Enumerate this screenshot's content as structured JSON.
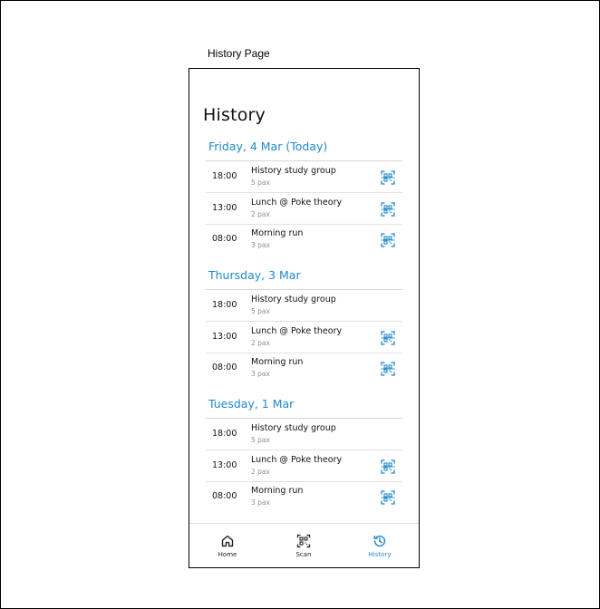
{
  "caption": "History Page",
  "title": "History",
  "sections": [
    {
      "header": "Friday, 4 Mar (Today)",
      "rows": [
        {
          "time": "18:00",
          "title": "History study group",
          "sub": "5 pax",
          "qr": true
        },
        {
          "time": "13:00",
          "title": "Lunch @ Poke theory",
          "sub": "2 pax",
          "qr": true
        },
        {
          "time": "08:00",
          "title": "Morning run",
          "sub": "3 pax",
          "qr": true
        }
      ]
    },
    {
      "header": "Thursday, 3 Mar",
      "rows": [
        {
          "time": "18:00",
          "title": "History study group",
          "sub": "5 pax",
          "qr": false
        },
        {
          "time": "13:00",
          "title": "Lunch @ Poke theory",
          "sub": "2 pax",
          "qr": true
        },
        {
          "time": "08:00",
          "title": "Morning run",
          "sub": "3 pax",
          "qr": true
        }
      ]
    },
    {
      "header": "Tuesday, 1 Mar",
      "rows": [
        {
          "time": "18:00",
          "title": "History study group",
          "sub": "5 pax",
          "qr": false
        },
        {
          "time": "13:00",
          "title": "Lunch @ Poke theory",
          "sub": "2 pax",
          "qr": true
        },
        {
          "time": "08:00",
          "title": "Morning run",
          "sub": "3 pax",
          "qr": true
        }
      ]
    }
  ],
  "nav": {
    "home": "Home",
    "scan": "Scan",
    "history": "History",
    "active": "history"
  },
  "colors": {
    "accent": "#1f8ac9"
  },
  "icons": {
    "row_action": "qr-code-scan-icon",
    "home": "home-icon",
    "scan": "qr-scan-icon",
    "history": "history-clock-icon"
  }
}
